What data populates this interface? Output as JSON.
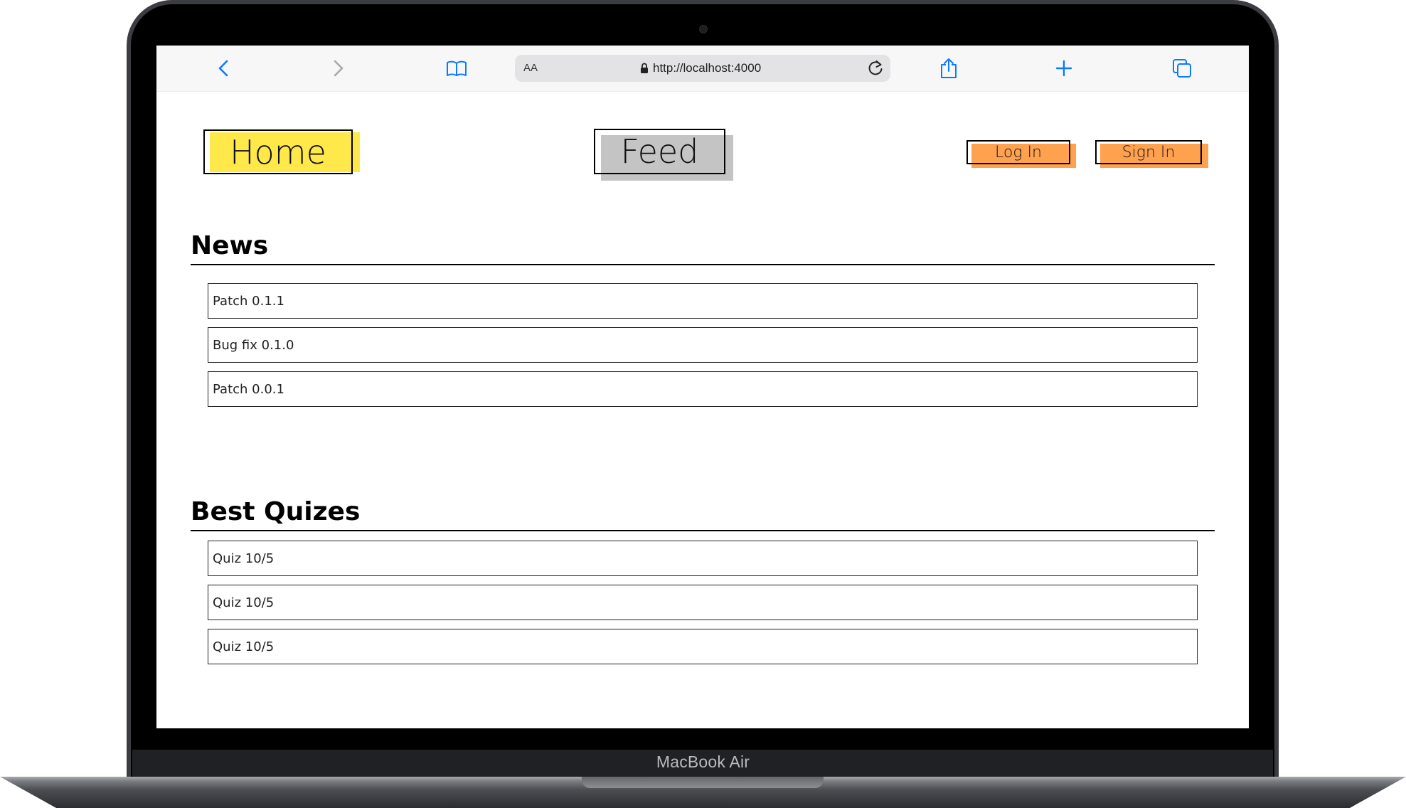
{
  "device": {
    "model_label": "MacBook Air"
  },
  "browser": {
    "text_size_label": "AA",
    "url": "http://localhost:4000"
  },
  "nav": {
    "home_label": "Home",
    "feed_label": "Feed",
    "login_label": "Log In",
    "signin_label": "Sign In",
    "colors": {
      "home": "#ffe84a",
      "feed": "#c4c4c4",
      "auth": "#ffa24f"
    }
  },
  "news": {
    "title": "News",
    "items": [
      "Patch 0.1.1",
      "Bug fix 0.1.0",
      "Patch 0.0.1"
    ]
  },
  "quizzes": {
    "title": "Best Quizes",
    "items": [
      "Quiz 10/5",
      "Quiz 10/5",
      "Quiz 10/5"
    ]
  }
}
